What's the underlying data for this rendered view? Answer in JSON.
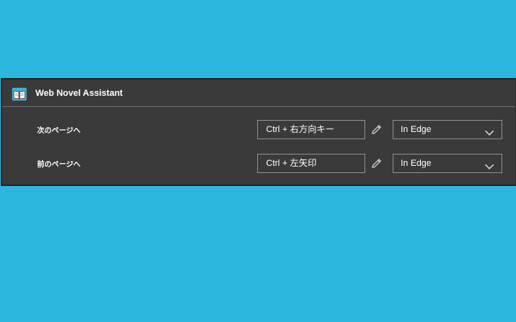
{
  "extension": {
    "title": "Web Novel Assistant",
    "icon": "open-book-icon"
  },
  "shortcuts": [
    {
      "label": "次のページへ",
      "keys": "Ctrl + 右方向キー",
      "edit_icon": "pencil-icon",
      "scope": "In Edge",
      "scope_icon": "chevron-down-icon"
    },
    {
      "label": "前のページへ",
      "keys": "Ctrl + 左矢印",
      "edit_icon": "pencil-icon",
      "scope": "In Edge",
      "scope_icon": "chevron-down-icon"
    }
  ],
  "colors": {
    "background": "#2bb6de",
    "panel": "#3a3a3a",
    "text": "#ffffff",
    "border": "#8a8a8a"
  }
}
